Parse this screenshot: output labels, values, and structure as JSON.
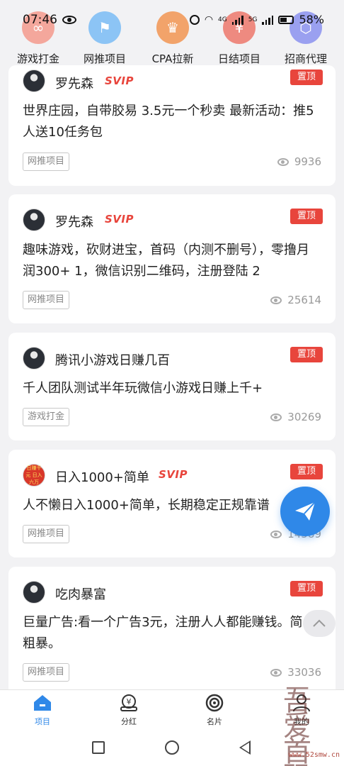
{
  "status_bar": {
    "time": "07:46",
    "network_a": "4G",
    "network_b": "5G",
    "battery": "58%"
  },
  "categories": [
    {
      "label": "游戏打金",
      "color": "#f2553f",
      "icon": "infinity-icon"
    },
    {
      "label": "网推项目",
      "color": "#4aa3f0",
      "icon": "flag-icon"
    },
    {
      "label": "CPA拉新",
      "color": "#f08a3a",
      "icon": "crown-icon"
    },
    {
      "label": "日结项目",
      "color": "#e8473c",
      "icon": "piggy-bank-icon"
    },
    {
      "label": "招商代理",
      "color": "#5a63e8",
      "icon": "shield-icon"
    }
  ],
  "posts": [
    {
      "author": "罗先森",
      "badge": "SVIP",
      "pin": "置顶",
      "text": "世界庄园，自带胶易 3.5元一个秒卖 最新活动：推5人送10任务包",
      "tag": "网推项目",
      "views": "9936"
    },
    {
      "author": "罗先森",
      "badge": "SVIP",
      "pin": "置顶",
      "text": "趣味游戏，砍财进宝，首码（内测不删号），零撸月润300+ 1，微信识别二维码，注册登陆 2",
      "tag": "网推项目",
      "views": "25614"
    },
    {
      "author": "腾讯小游戏日赚几百",
      "badge": "",
      "pin": "置顶",
      "text": "千人团队测试半年玩微信小游戏日赚上千+",
      "tag": "游戏打金",
      "views": "30269"
    },
    {
      "author": "日入1000+简单",
      "badge": "SVIP",
      "pin": "置顶",
      "avatar_text": "日赚千元 日入六万",
      "text": "人不懒日入1000+简单，长期稳定正规靠谱",
      "tag": "网推项目",
      "views": "14589"
    },
    {
      "author": "吃肉暴富",
      "badge": "",
      "pin": "置顶",
      "text": "巨量广告:看一个广告3元，注册人人都能赚钱。简单粗暴。",
      "tag": "网推项目",
      "views": "33036"
    }
  ],
  "tabs": [
    {
      "label": "项目",
      "icon": "home-icon",
      "active": true
    },
    {
      "label": "分红",
      "icon": "yen-wallet-icon",
      "active": false
    },
    {
      "label": "名片",
      "icon": "target-icon",
      "active": false
    },
    {
      "label": "我的",
      "icon": "user-icon",
      "active": false
    }
  ],
  "watermark": {
    "seal": "吾爱首码",
    "url": "www.52smw.cn"
  }
}
